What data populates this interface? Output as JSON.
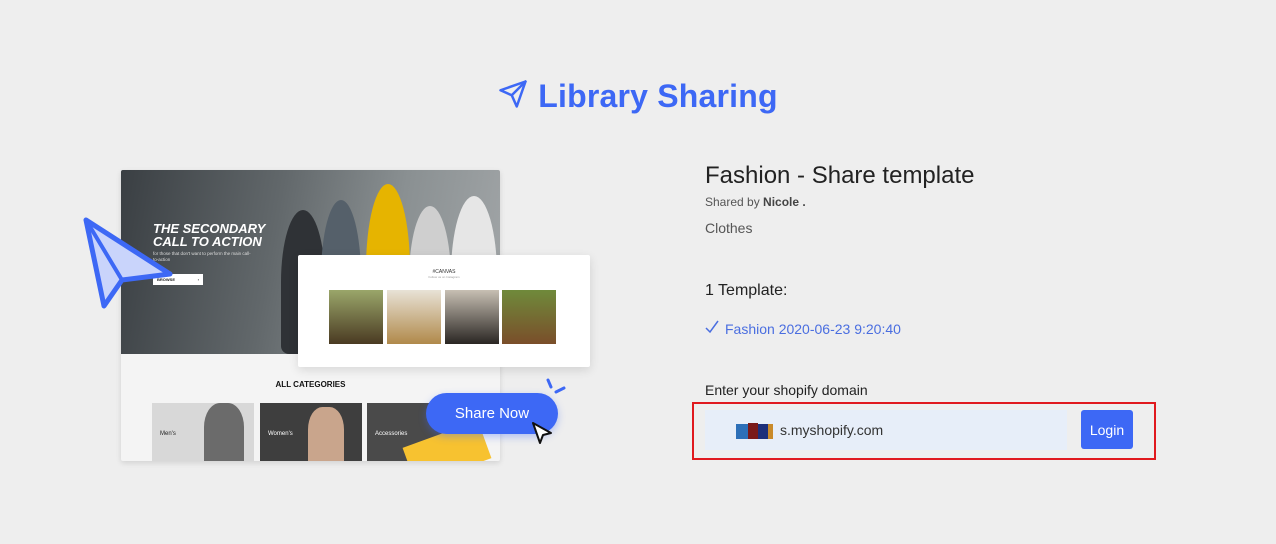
{
  "header": {
    "title": "Library Sharing",
    "icon": "paper-plane-icon"
  },
  "illustration": {
    "hero_heading_line1": "THE SECONDARY",
    "hero_heading_line2": "CALL TO ACTION",
    "hero_text": "for those that don't want to perform the main call-to-action",
    "hero_button": "BROWSE",
    "card_title": "#CANVAS",
    "card_subtitle": "Follow us on Instagram",
    "categories_title": "ALL CATEGORIES",
    "categories": [
      "Men's",
      "Women's",
      "Accessories"
    ],
    "share_button": "Share Now"
  },
  "template": {
    "title": "Fashion - Share template",
    "shared_by_prefix": "Shared by",
    "shared_by_name": "Nicole .",
    "category": "Clothes",
    "count_label": "1 Template:",
    "items": [
      "Fashion 2020-06-23 9:20:40"
    ]
  },
  "login": {
    "label": "Enter your shopify domain",
    "domain_value": "s.myshopify.com",
    "button": "Login"
  },
  "colors": {
    "accent": "#3d68f5",
    "highlight_border": "#e0191e",
    "input_bg": "#e7eef9"
  }
}
